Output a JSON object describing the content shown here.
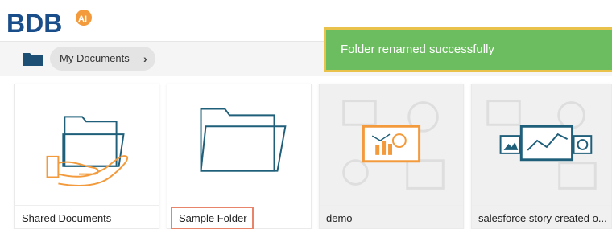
{
  "app": {
    "logo_text": "BDB",
    "logo_badge": "AI"
  },
  "breadcrumb": {
    "label": "My Documents",
    "chevron": "›"
  },
  "toast": {
    "message": "Folder renamed successfully"
  },
  "cards": [
    {
      "label": "Shared Documents",
      "icon": "shared-folder-icon"
    },
    {
      "label": "Sample Folder",
      "icon": "folder-icon"
    },
    {
      "label": "demo",
      "icon": "story-icon"
    },
    {
      "label": "salesforce story created o...",
      "icon": "story-chart-icon"
    }
  ],
  "colors": {
    "toast_bg": "#6cbd60",
    "toast_border": "#e8c24a",
    "accent_orange": "#f29a3c",
    "accent_teal": "#1f5f7a",
    "highlight": "#e8846a"
  }
}
